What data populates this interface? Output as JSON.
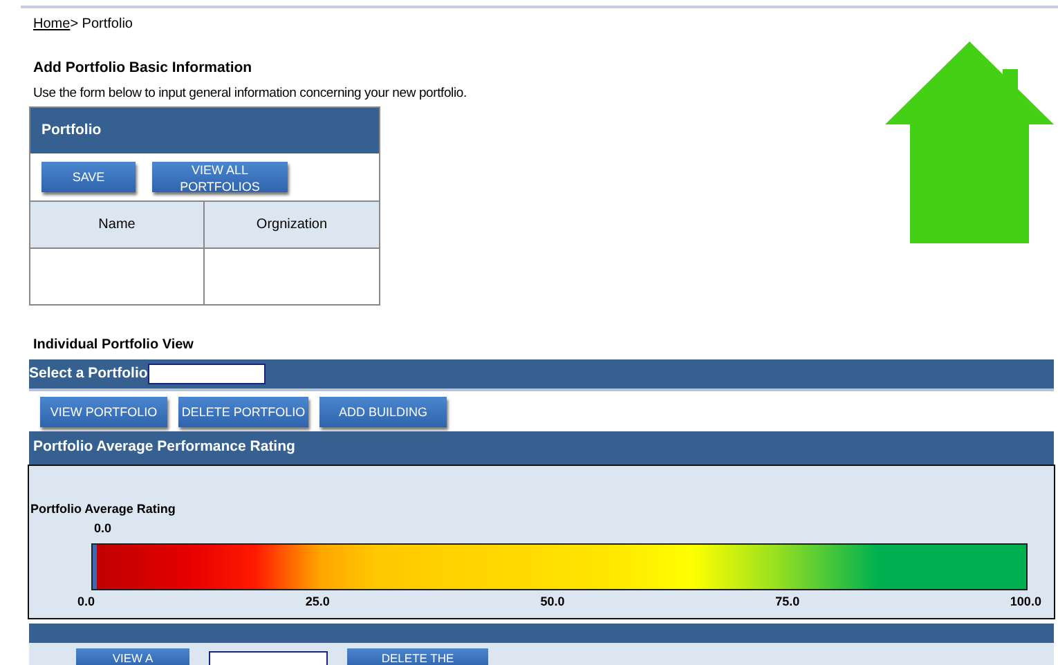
{
  "breadcrumb": {
    "link": "Home",
    "rest": "> Portfolio"
  },
  "add_section": {
    "title": "Add Portfolio Basic Information",
    "description": "Use the form below to input general information concerning your new portfolio.",
    "panel_title": "Portfolio",
    "buttons": [
      "SAVE",
      "VIEW ALL PORTFOLIOS"
    ],
    "columns": [
      "Name",
      "Orgnization"
    ]
  },
  "view_section": {
    "title": "Individual Portfolio View",
    "select_label": "Select a Portfolio",
    "buttons": [
      "VIEW PORTFOLIO",
      "DELETE PORTFOLIO",
      "ADD BUILDING"
    ],
    "rating_title": "Portfolio Average Performance Rating",
    "rating_label": "Portfolio Average Rating",
    "rating_value": "0.0",
    "level": 0,
    "ticks": [
      "0.0",
      "25.0",
      "50.0",
      "75.0",
      "100.0"
    ],
    "bottom_buttons": [
      "VIEW  A",
      "DELETE THE"
    ]
  }
}
